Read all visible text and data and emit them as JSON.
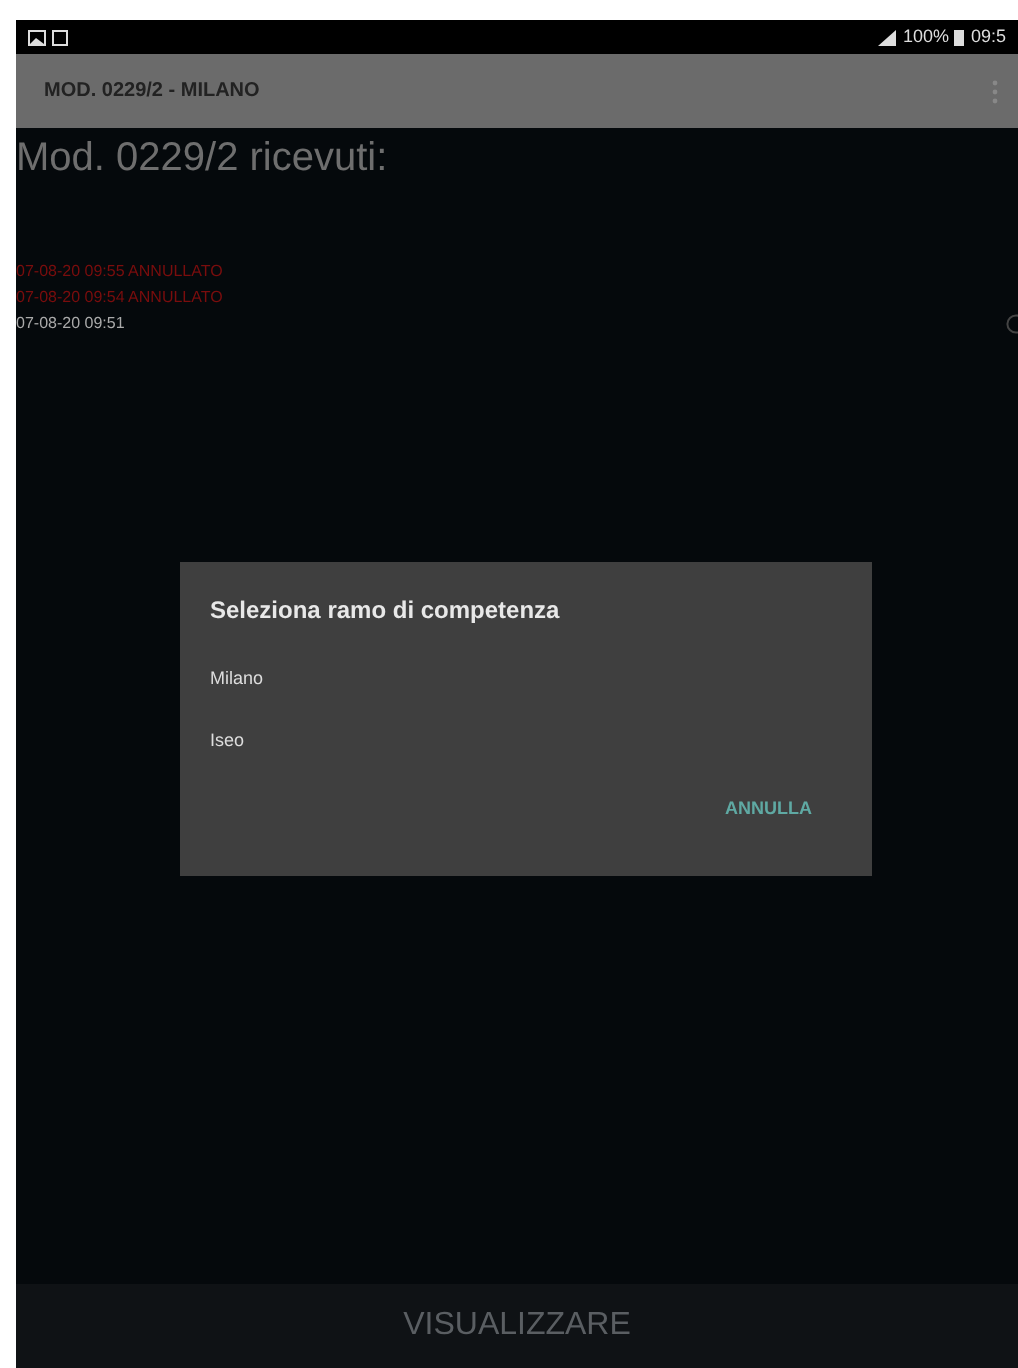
{
  "status_bar": {
    "battery": "100%",
    "time": "09:5"
  },
  "app_bar": {
    "title": "MOD. 0229/2 - MILANO"
  },
  "heading": "Mod. 0229/2 ricevuti:",
  "records": [
    {
      "text": "07-08-20 09:55 ANNULLATO",
      "cancelled": true
    },
    {
      "text": "07-08-20 09:54 ANNULLATO",
      "cancelled": true
    },
    {
      "text": "07-08-20 09:51",
      "cancelled": false,
      "selected": false
    }
  ],
  "dialog": {
    "title": "Seleziona ramo di competenza",
    "options": [
      "Milano",
      "Iseo"
    ],
    "button": "ANNULLA"
  },
  "bottom_button": "VISUALIZZARE"
}
